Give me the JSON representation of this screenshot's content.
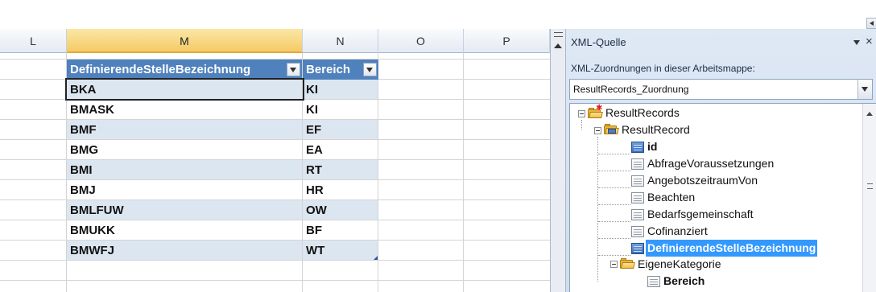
{
  "columns": [
    "L",
    "M",
    "N",
    "O",
    "P"
  ],
  "selected_column": "M",
  "table": {
    "headers": [
      "DefinierendeStelleBezeichnung",
      "Bereich"
    ],
    "rows": [
      [
        "BKA",
        "KI"
      ],
      [
        "BMASK",
        "KI"
      ],
      [
        "BMF",
        "EF"
      ],
      [
        "BMG",
        "EA"
      ],
      [
        "BMI",
        "RT"
      ],
      [
        "BMJ",
        "HR"
      ],
      [
        "BMLFUW",
        "OW"
      ],
      [
        "BMUKK",
        "BF"
      ],
      [
        "BMWFJ",
        "WT"
      ]
    ],
    "header_color": "#4f81bd",
    "band_color": "#dce6f1"
  },
  "xml_pane": {
    "title": "XML-Quelle",
    "close_glyph": "×",
    "maps_label": "XML-Zuordnungen in dieser Arbeitsmappe:",
    "selected_map": "ResultRecords_Zuordnung",
    "tree": [
      {
        "label": "ResultRecords",
        "icon": "root-folder-icon",
        "bold": false,
        "selected": false
      },
      {
        "label": "ResultRecord",
        "icon": "repeating-folder-icon",
        "bold": false,
        "selected": false
      },
      {
        "label": "id",
        "icon": "mapped-element-icon",
        "bold": true,
        "selected": false
      },
      {
        "label": "AbfrageVoraussetzungen",
        "icon": "element-icon",
        "bold": false,
        "selected": false
      },
      {
        "label": "AngebotszeitraumVon",
        "icon": "element-icon",
        "bold": false,
        "selected": false
      },
      {
        "label": "Beachten",
        "icon": "element-icon",
        "bold": false,
        "selected": false
      },
      {
        "label": "Bedarfsgemeinschaft",
        "icon": "element-icon",
        "bold": false,
        "selected": false
      },
      {
        "label": "Cofinanziert",
        "icon": "element-icon",
        "bold": false,
        "selected": false
      },
      {
        "label": "DefinierendeStelleBezeichnung",
        "icon": "mapped-element-icon",
        "bold": true,
        "selected": true
      },
      {
        "label": "EigeneKategorie",
        "icon": "folder-icon",
        "bold": false,
        "selected": false
      },
      {
        "label": "Bereich",
        "icon": "element-icon",
        "bold": true,
        "selected": false
      }
    ],
    "selection_color": "#3399ff"
  }
}
